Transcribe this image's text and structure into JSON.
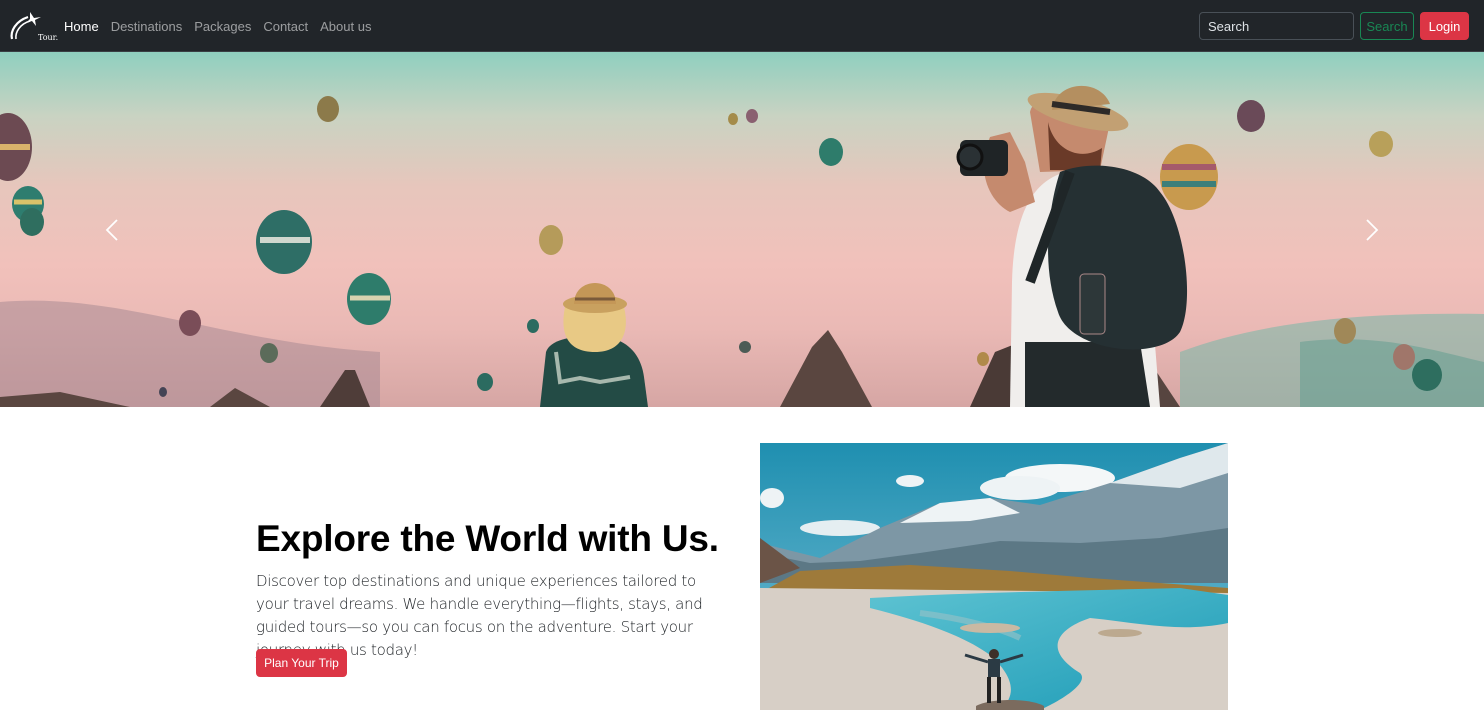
{
  "navbar": {
    "brand_text": "Tour.",
    "links": [
      {
        "label": "Home",
        "active": true
      },
      {
        "label": "Destinations",
        "active": false
      },
      {
        "label": "Packages",
        "active": false
      },
      {
        "label": "Contact",
        "active": false
      },
      {
        "label": "About us",
        "active": false
      }
    ],
    "search_placeholder": "Search",
    "search_button": "Search",
    "login_button": "Login"
  },
  "hero": {
    "prev_icon": "chevron-left-icon",
    "next_icon": "chevron-right-icon"
  },
  "content": {
    "title": "Explore the World with Us.",
    "text": "Discover top destinations and unique experiences tailored to your travel dreams. We handle everything—flights, stays, and guided tours—so you can focus on the adventure. Start your journey with us today!",
    "cta_button": "Plan Your Trip"
  },
  "colors": {
    "navbar_bg": "#212529",
    "accent_red": "#dc3545",
    "accent_green": "#198754"
  }
}
